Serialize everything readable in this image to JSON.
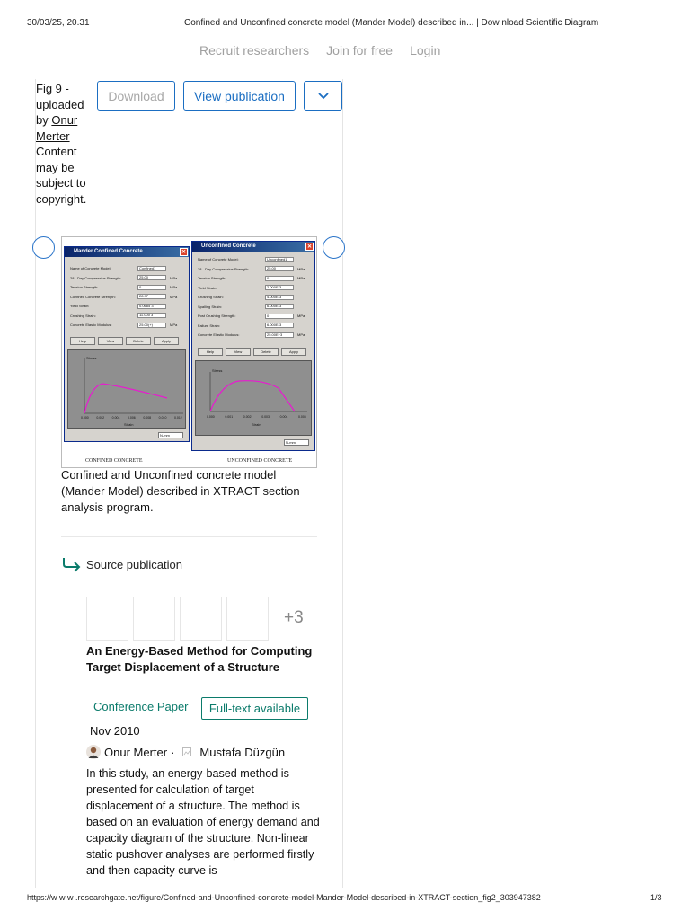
{
  "print_header": {
    "datetime": "30/03/25, 20.31",
    "page_title": "Confined and Unconfined concrete model (Mander Model) described in... | Dow nload Scientific Diagram"
  },
  "top_nav": {
    "recruit": "Recruit researchers",
    "join": "Join for free",
    "login": "Login"
  },
  "fig_info": {
    "fig": "Fig 9 -",
    "uploaded": "uploaded",
    "by": "by",
    "uploader_first": "Onur",
    "uploader_last": "Merter",
    "notice": "Content may be subject to copyright."
  },
  "actions": {
    "download": "Download",
    "view_publication": "View publication",
    "more_icon": "chevron-down-icon"
  },
  "figure": {
    "left_panel": {
      "title": "Mander Confined Concrete",
      "fields": [
        {
          "label": "Name of Concrete Model:",
          "value": "Confined1",
          "unit": ""
        },
        {
          "label": "28 - Day Compressive Strength:",
          "value": "25.00",
          "unit": "MPa"
        },
        {
          "label": "Tension Strength:",
          "value": "0",
          "unit": "MPa"
        },
        {
          "label": "Confined Concrete Strength:",
          "value": "28.97",
          "unit": "MPa"
        },
        {
          "label": "Yield Strain:",
          "value": "0.0685 3",
          "unit": ""
        },
        {
          "label": "Crushing Strain:",
          "value": "11.000 3",
          "unit": ""
        },
        {
          "label": "Concrete Elastic Modulus:",
          "value": "25.00(+)",
          "unit": "MPa"
        }
      ],
      "buttons": [
        "Help",
        "View",
        "Delete",
        "Apply"
      ],
      "y_axis": "Stress",
      "x_axis": "Strain",
      "x_ticks": [
        "0.000",
        "0.002",
        "0.004",
        "0.006",
        "0.008",
        "0.010",
        "0.012"
      ],
      "unit_select": "N-mm",
      "caption": "CONFINED CONCRETE"
    },
    "right_panel": {
      "title": "Unconfined Concrete",
      "fields": [
        {
          "label": "Name of Concrete Model:",
          "value": "Unconfined1",
          "unit": ""
        },
        {
          "label": "28 - Day Compressive Strength:",
          "value": "25.00",
          "unit": "MPa"
        },
        {
          "label": "Tension Strength:",
          "value": "0",
          "unit": "MPa"
        },
        {
          "label": "Yield Strain:",
          "value": "2.000E-3",
          "unit": ""
        },
        {
          "label": "Crushing Strain:",
          "value": "4.000E-3",
          "unit": ""
        },
        {
          "label": "Spalling Strain:",
          "value": "6.000E-3",
          "unit": ""
        },
        {
          "label": "Post Crushing Strength:",
          "value": "0",
          "unit": "MPa"
        },
        {
          "label": "Failure Strain:",
          "value": "6.000E-3",
          "unit": ""
        },
        {
          "label": "Concrete Elastic Modulus:",
          "value": "25.00E+3",
          "unit": "MPa"
        }
      ],
      "buttons": [
        "Help",
        "View",
        "Delete",
        "Apply"
      ],
      "y_axis": "Stress",
      "x_axis": "Strain",
      "x_ticks": [
        "0.000",
        "0.001",
        "0.002",
        "0.003",
        "0.004",
        "0.005"
      ],
      "unit_select": "N-mm",
      "caption": "UNCONFINED CONCRETE"
    }
  },
  "figure_caption": "Confined and Unconfined concrete model (Mander Model) described in XTRACT section analysis program.",
  "source": {
    "label": "Source publication",
    "more_count": "+3",
    "title": "An Energy-Based Method for Computing Target Displacement of a Structure",
    "type": "Conference Paper",
    "availability": "Full-text available",
    "date": "Nov 2010",
    "author1": "Onur Merter",
    "author_sep": "·",
    "author2": "Mustafa Düzgün",
    "abstract": "In this study, an energy-based method is presented for calculation of target displacement of a structure. The method is based on an evaluation of energy demand and capacity diagram of the structure. Non-linear static pushover analyses are performed firstly and then capacity curve is"
  },
  "print_footer": {
    "url": "https://w w w .researchgate.net/figure/Confined-and-Unconfined-concrete-model-Mander-Model-described-in-XTRACT-section_fig2_303947382",
    "page": "1/3"
  },
  "colors": {
    "accent": "#1b6ec2",
    "teal": "#0b7b6b",
    "curve": "#e81ad0"
  }
}
